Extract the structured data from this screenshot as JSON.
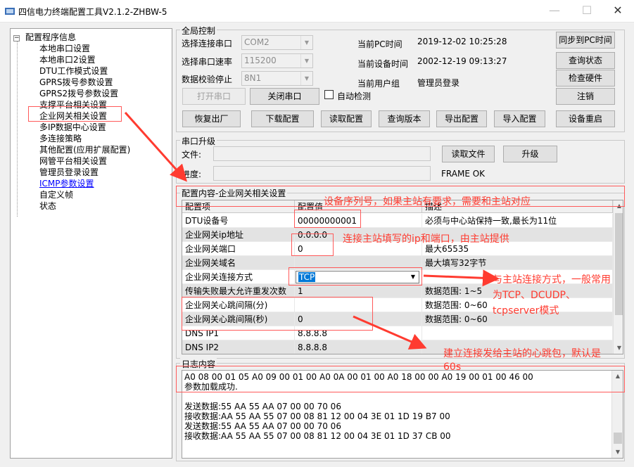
{
  "window": {
    "title": "四信电力终端配置工具V2.1.2-ZHBW-5",
    "controls": {
      "minimize": "—",
      "maximize": "☐",
      "close": "✕"
    }
  },
  "tree": {
    "root": "配置程序信息",
    "items": [
      "本地串口设置",
      "本地串口2设置",
      "DTU工作模式设置",
      "GPRS拨号参数设置",
      "GPRS2拨号参数设置",
      "支撑平台相关设置",
      "企业网关相关设置",
      "多IP数据中心设置",
      "多连接策略",
      "其他配置(应用扩展配置)",
      "网管平台相关设置",
      "管理员登录设置",
      "ICMP参数设置",
      "自定义帧",
      "状态"
    ]
  },
  "global": {
    "label": "全局控制",
    "port_label": "选择连接串口",
    "port_value": "COM2",
    "baud_label": "选择串口速率",
    "baud_value": "115200",
    "parity_label": "数据校验停止",
    "parity_value": "8N1",
    "open_port": "打开串口",
    "close_port": "关闭串口",
    "auto_detect": "自动检测",
    "pc_time_label": "当前PC时间",
    "pc_time_value": "2019-12-02 10:25:28",
    "dev_time_label": "当前设备时间",
    "dev_time_value": "2002-12-19 09:13:27",
    "user_group_label": "当前用户组",
    "user_group_value": "管理员登录",
    "sync_pc_time": "同步到PC时间",
    "query_status": "查询状态",
    "check_hw": "检查硬件",
    "logout": "注销",
    "restore_factory": "恢复出厂",
    "download_cfg": "下载配置",
    "read_cfg": "读取配置",
    "query_version": "查询版本",
    "export_cfg": "导出配置",
    "import_cfg": "导入配置",
    "reboot": "设备重启"
  },
  "serial_upgrade": {
    "label": "串口升级",
    "file_label": "文件:",
    "progress_label": "进度:",
    "read_file": "读取文件",
    "upgrade": "升级",
    "status": "FRAME OK"
  },
  "config": {
    "label": "配置内容-企业网关相关设置",
    "headers": [
      "配置项",
      "配置值",
      "描述"
    ],
    "rows": [
      {
        "name": "DTU设备号",
        "value": "00000000001",
        "desc": "必须与中心站保持一致,最长为11位"
      },
      {
        "name": "企业网关ip地址",
        "value": "0.0.0.0",
        "desc": ""
      },
      {
        "name": "企业网关端口",
        "value": "0",
        "desc": "最大65535"
      },
      {
        "name": "企业网关域名",
        "value": "",
        "desc": "最大填写32字节"
      },
      {
        "name": "企业网关连接方式",
        "value": "TCP",
        "desc": ""
      },
      {
        "name": "传输失败最大允许重发次数",
        "value": "1",
        "desc": "数据范围: 1~5"
      },
      {
        "name": "企业网关心跳间隔(分)",
        "value": "",
        "desc": "数据范围: 0~60"
      },
      {
        "name": "企业网关心跳间隔(秒)",
        "value": "0",
        "desc": "数据范围: 0~60"
      },
      {
        "name": "DNS IP1",
        "value": "8.8.8.8",
        "desc": ""
      },
      {
        "name": "DNS IP2",
        "value": "8.8.8.8",
        "desc": ""
      }
    ]
  },
  "log": {
    "label": "日志内容",
    "lines": [
      "A0 08 00 01 05 A0 09 00 01 00 A0 0A 00 01 00 A0 18 00 00 A0 19 00 01 00 46 00",
      "参数加载成功.",
      "",
      "",
      "发送数据:55 AA 55 AA 07 00 00 70 06",
      "接收数据:AA 55 AA 55 07 00 08 81 12 00 04 3E 01 1D 19 B7 00",
      "发送数据:55 AA 55 AA 07 00 00 70 06",
      "接收数据:AA 55 AA 55 07 00 08 81 12 00 04 3E 01 1D 37 CB 00"
    ]
  },
  "annotations": {
    "device_id": "设备序列号，如果主站有要求，需要和主站对应",
    "ip_port": "连接主站填写的ip和端口，由主站提供",
    "conn_mode_1": "与主站连接方式，一般常用",
    "conn_mode_2": "为TCP、DCUDP、",
    "conn_mode_3": "tcpserver模式",
    "heartbeat_1": "建立连接发给主站的心跳包，默认是",
    "heartbeat_2": "60s"
  },
  "colors": {
    "annotation": "#ff3b30",
    "selection": "#0078d7"
  }
}
